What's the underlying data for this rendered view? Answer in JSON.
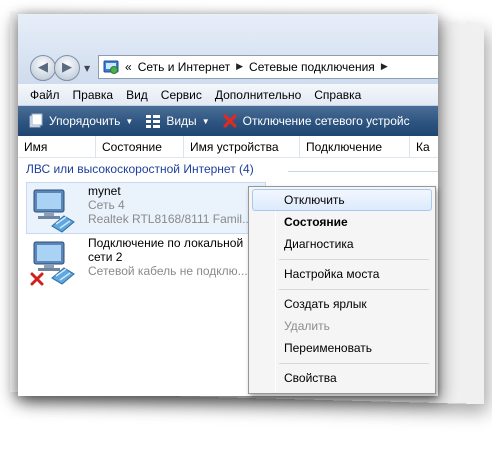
{
  "address": {
    "overflow": "«",
    "crumbs": [
      "Сеть и Интернет",
      "Сетевые подключения"
    ]
  },
  "menu": [
    "Файл",
    "Правка",
    "Вид",
    "Сервис",
    "Дополнительно",
    "Справка"
  ],
  "toolbar": {
    "organize": "Упорядочить",
    "views": "Виды",
    "disconnect": "Отключение сетевого устройс"
  },
  "columns": [
    "Имя",
    "Состояние",
    "Имя устройства",
    "Подключение",
    "Ка"
  ],
  "group": "ЛВС или высокоскоростной Интернет (4)",
  "connections": [
    {
      "name": "mynet",
      "status": "Сеть  4",
      "device": "Realtek RTL8168/8111 Famil..."
    },
    {
      "name_line1": "Подключение по локальной",
      "name_line2": "сети 2",
      "status": "Сетевой кабель не подклю..."
    }
  ],
  "context_menu": {
    "disable": "Отключить",
    "status": "Состояние",
    "diagnose": "Диагностика",
    "bridge": "Настройка моста",
    "shortcut": "Создать ярлык",
    "delete": "Удалить",
    "rename": "Переименовать",
    "properties": "Свойства"
  },
  "colors": {
    "command_bar": "#2d5480",
    "group_text": "#1e3e9c",
    "error_red": "#d0201b"
  }
}
